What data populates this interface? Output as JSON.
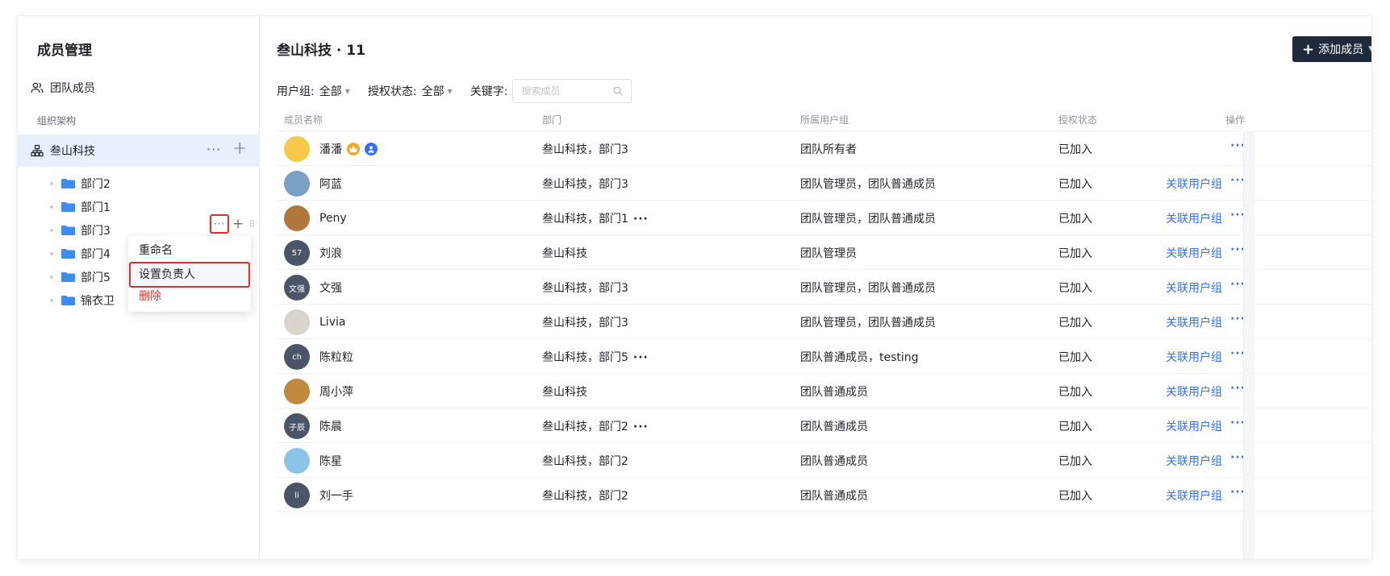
{
  "sidebar": {
    "title": "成员管理",
    "team_members": "团队成员",
    "org_label": "组织架构",
    "org_name": "叁山科技",
    "org_more": "···",
    "org_add": "+",
    "departments": [
      "部门2",
      "部门1",
      "部门3",
      "部门4",
      "部门5",
      "锦衣卫"
    ],
    "dept_more": "···",
    "dept_add": "+",
    "dept_drag": "⠿",
    "context_menu": {
      "rename": "重命名",
      "set_owner": "设置负责人",
      "delete": "删除"
    }
  },
  "main": {
    "title": "叁山科技 · 11",
    "add_button": "添加成员",
    "filters": {
      "group_label": "用户组:",
      "group_value": "全部",
      "auth_label": "授权状态:",
      "auth_value": "全部",
      "keyword_label": "关键字:",
      "search_placeholder": "搜索成员"
    },
    "columns": {
      "name": "成员名称",
      "dept": "部门",
      "group": "所属用户组",
      "status": "授权状态",
      "action": "操作"
    },
    "link_label": "关联用户组",
    "more_label": "···",
    "members": [
      {
        "name": "潘潘",
        "avatar_text": "",
        "avatar_color": "#f7c948",
        "dept": "叁山科技，部门3",
        "dept_more": "",
        "group": "团队所有者",
        "status": "已加入",
        "link": ""
      },
      {
        "name": "阿蓝",
        "avatar_text": "",
        "avatar_color": "#7aa0c4",
        "dept": "叁山科技，部门3",
        "dept_more": "",
        "group": "团队管理员，团队普通成员",
        "status": "已加入",
        "link": "关联用户组"
      },
      {
        "name": "Peny",
        "avatar_text": "",
        "avatar_color": "#b0763c",
        "dept": "叁山科技，部门1",
        "dept_more": "···",
        "group": "团队管理员，团队普通成员",
        "status": "已加入",
        "link": "关联用户组"
      },
      {
        "name": "刘浪",
        "avatar_text": "57",
        "avatar_color": "#4a5568",
        "dept": "叁山科技",
        "dept_more": "",
        "group": "团队管理员",
        "status": "已加入",
        "link": "关联用户组"
      },
      {
        "name": "文强",
        "avatar_text": "文强",
        "avatar_color": "#4a5568",
        "dept": "叁山科技，部门3",
        "dept_more": "",
        "group": "团队管理员，团队普通成员",
        "status": "已加入",
        "link": "关联用户组"
      },
      {
        "name": "Livia",
        "avatar_text": "",
        "avatar_color": "#d9d4cc",
        "dept": "叁山科技，部门3",
        "dept_more": "",
        "group": "团队管理员，团队普通成员",
        "status": "已加入",
        "link": "关联用户组"
      },
      {
        "name": "陈粒粒",
        "avatar_text": "ch",
        "avatar_color": "#4a5568",
        "dept": "叁山科技，部门5",
        "dept_more": "···",
        "group": "团队普通成员，testing",
        "status": "已加入",
        "link": "关联用户组"
      },
      {
        "name": "周小萍",
        "avatar_text": "",
        "avatar_color": "#c08a3e",
        "dept": "叁山科技",
        "dept_more": "",
        "group": "团队普通成员",
        "status": "已加入",
        "link": "关联用户组"
      },
      {
        "name": "陈晨",
        "avatar_text": "子辰",
        "avatar_color": "#4a5568",
        "dept": "叁山科技，部门2",
        "dept_more": "···",
        "group": "团队普通成员",
        "status": "已加入",
        "link": "关联用户组"
      },
      {
        "name": "陈星",
        "avatar_text": "",
        "avatar_color": "#8cc4e8",
        "dept": "叁山科技，部门2",
        "dept_more": "",
        "group": "团队普通成员",
        "status": "已加入",
        "link": "关联用户组"
      },
      {
        "name": "刘一手",
        "avatar_text": "li",
        "avatar_color": "#4a5568",
        "dept": "叁山科技，部门2",
        "dept_more": "",
        "group": "团队普通成员",
        "status": "已加入",
        "link": "关联用户组"
      }
    ]
  }
}
